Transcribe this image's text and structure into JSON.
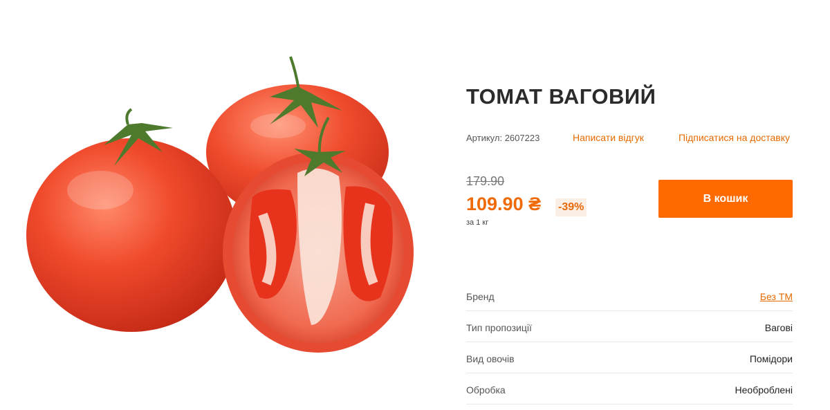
{
  "product": {
    "title": "ТОМАТ ВАГОВИЙ",
    "sku": "Артикул: 2607223",
    "review_link": "Написати відгук",
    "subscribe_link": "Підписатися на доставку",
    "old_price": "179.90",
    "price": "109.90 ₴",
    "discount": "-39%",
    "unit": "за 1 кг",
    "cart_button": "В кошик",
    "image_icon": "tomato-image"
  },
  "specs": [
    {
      "label": "Бренд",
      "value": "Без ТМ",
      "is_link": true
    },
    {
      "label": "Тип пропозиції",
      "value": "Вагові",
      "is_link": false
    },
    {
      "label": "Вид овочів",
      "value": "Помідори",
      "is_link": false
    },
    {
      "label": "Обробка",
      "value": "Необроблені",
      "is_link": false
    }
  ],
  "colors": {
    "accent": "#ff6a00",
    "price": "#ef6b08",
    "link": "#e66a00"
  }
}
